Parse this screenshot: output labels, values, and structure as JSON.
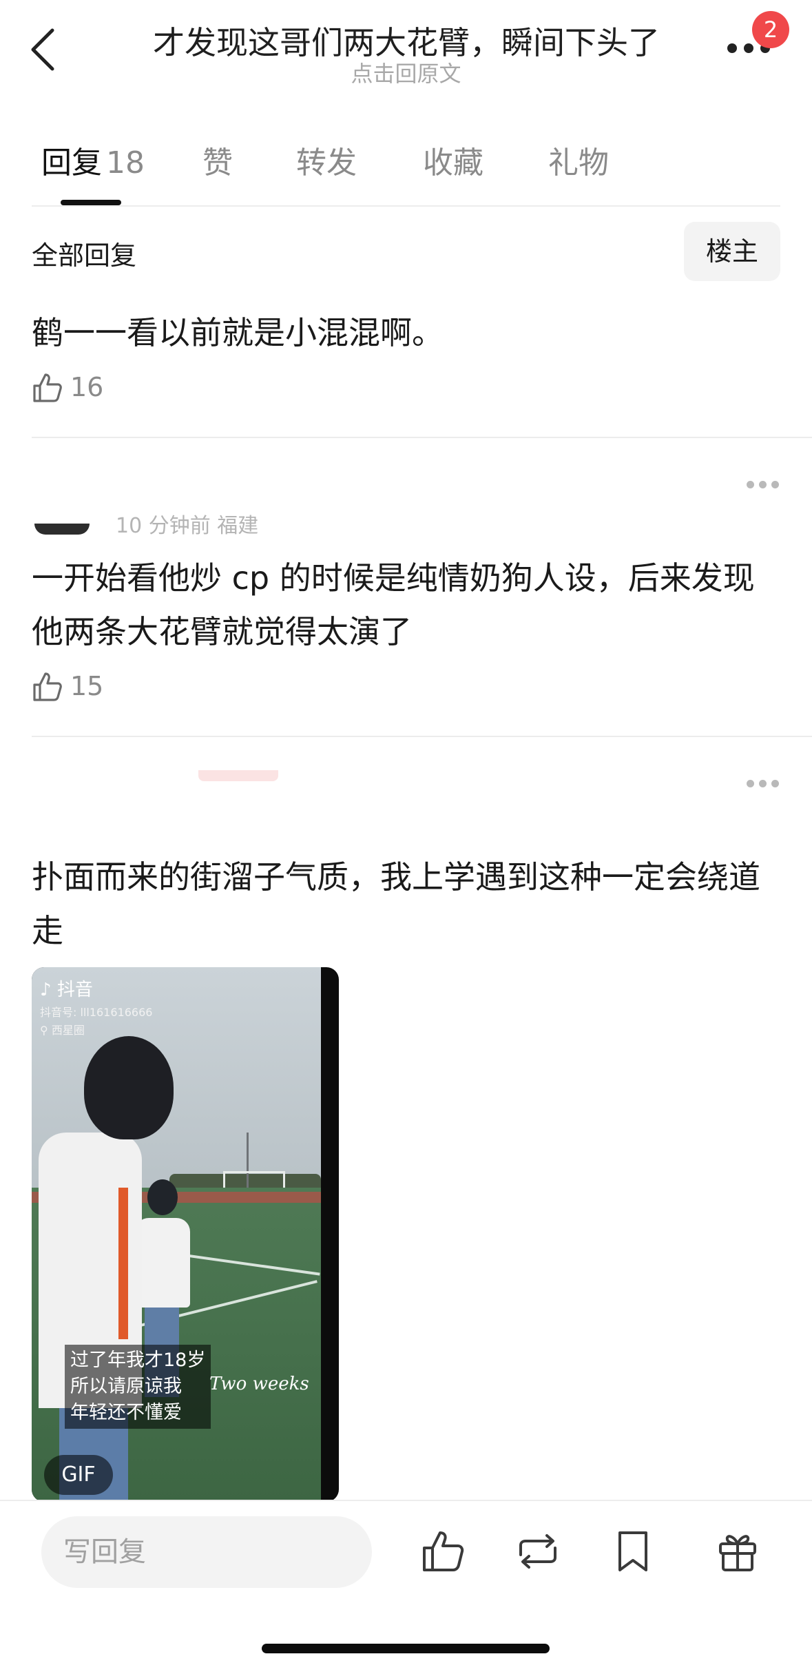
{
  "header": {
    "title": "才发现这哥们两大花臂，瞬间下头了",
    "subtitle": "点击回原文",
    "badge_count": "2"
  },
  "tabs": [
    {
      "label": "回复",
      "count": "18",
      "active": true
    },
    {
      "label": "赞",
      "active": false
    },
    {
      "label": "转发",
      "active": false
    },
    {
      "label": "收藏",
      "active": false
    },
    {
      "label": "礼物",
      "active": false
    }
  ],
  "filter": {
    "label": "全部回复",
    "owner_button": "楼主"
  },
  "comments": [
    {
      "text": "鹤一一看以前就是小混混啊。",
      "likes": "16"
    },
    {
      "meta": "10 分钟前  福建",
      "text": "一开始看他炒 cp 的时候是纯情奶狗人设，后来发现他两条大花臂就觉得太演了",
      "likes": "15"
    },
    {
      "text": "扑面而来的街溜子气质，我上学遇到这种一定会绕道走",
      "media": {
        "app_name": "抖音",
        "account_id": "抖音号: lll161616666",
        "location": "西星圈",
        "caption": [
          "过了年我才18岁",
          "所以请原谅我",
          "年轻还不懂爱"
        ],
        "overlay_text": "Two  weeks",
        "type_badge": "GIF"
      }
    }
  ],
  "bottom_bar": {
    "reply_placeholder": "写回复",
    "icons": [
      "like-icon",
      "repost-icon",
      "bookmark-icon",
      "gift-icon"
    ]
  }
}
